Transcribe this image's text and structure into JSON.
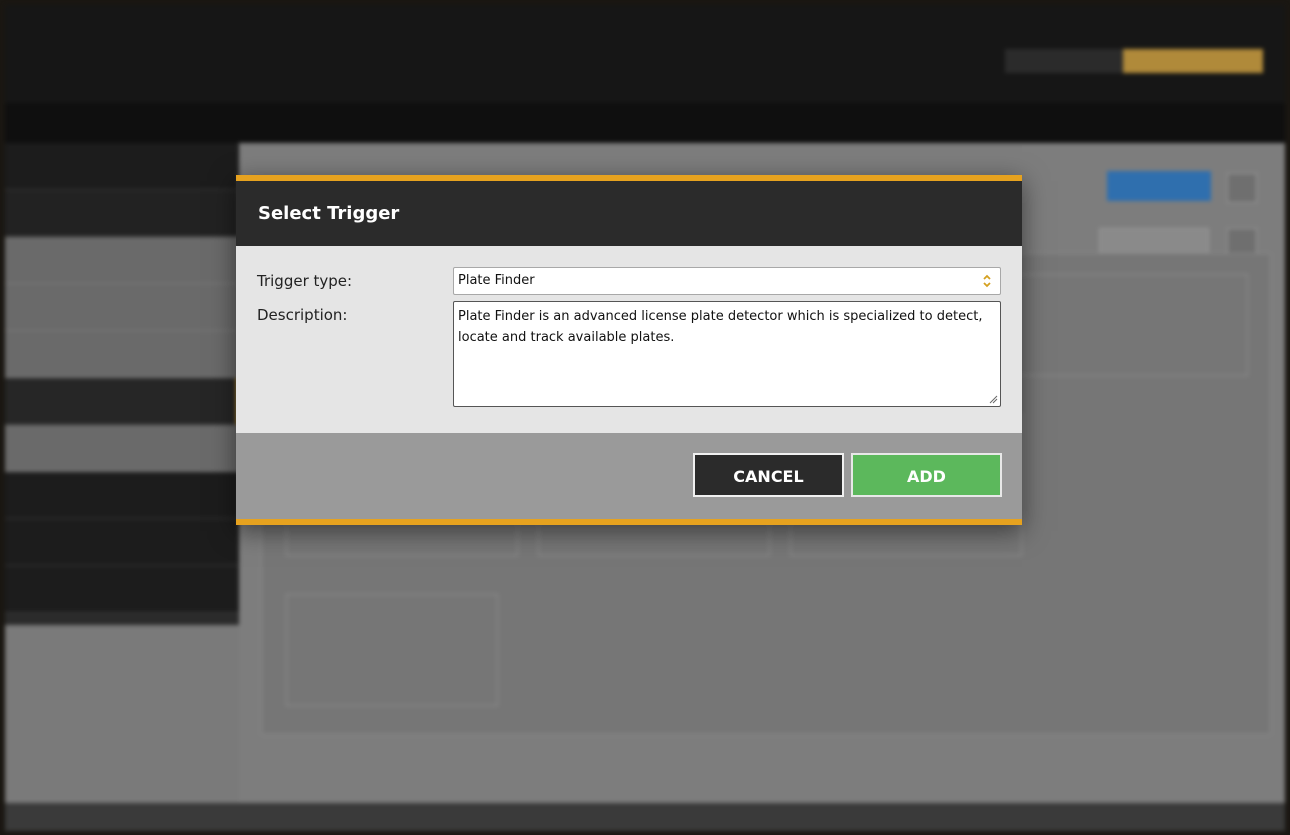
{
  "modal": {
    "title": "Select Trigger",
    "trigger_type_label": "Trigger type:",
    "trigger_type_value": "Plate Finder",
    "description_label": "Description:",
    "description_text": "Plate Finder is an advanced license plate detector which is specialized to detect, locate and track available plates.",
    "cancel_label": "CANCEL",
    "add_label": "ADD"
  },
  "colors": {
    "accent": "#e6a21f",
    "add_button": "#5cb85c",
    "header": "#2b2b2b",
    "primary_blue": "#2f6fae"
  },
  "icons": {
    "select_arrow": "updown-chevron-icon",
    "textarea_resize": "resize-grip-icon"
  }
}
